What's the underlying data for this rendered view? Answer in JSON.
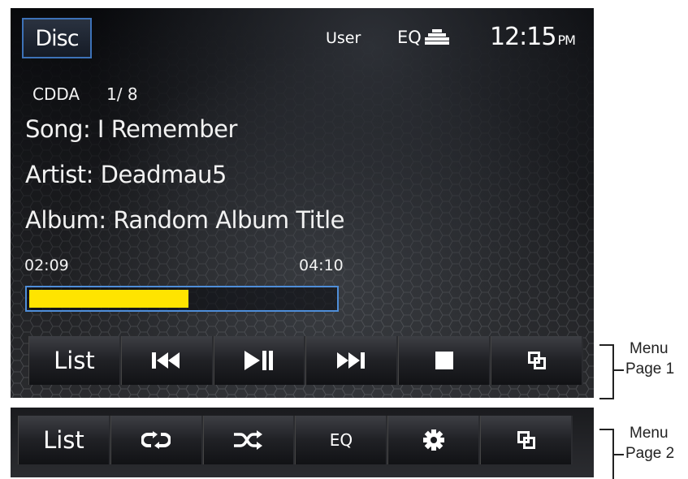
{
  "header": {
    "source_button": "Disc",
    "eq_mode": "User",
    "eq_label": "EQ",
    "clock_time": "12:15",
    "clock_ampm": "PM"
  },
  "track": {
    "format": "CDDA",
    "position": "1/ 8",
    "song": "Song: I Remember",
    "artist": "Artist: Deadmau5",
    "album": "Album: Random Album Title"
  },
  "playback": {
    "elapsed": "02:09",
    "total": "04:10",
    "progress_fraction": 0.52
  },
  "menu_page1": {
    "list_label": "List",
    "icons": [
      "previous-track-icon",
      "play-pause-icon",
      "next-track-icon",
      "stop-icon",
      "page-switch-icon"
    ]
  },
  "menu_page2": {
    "list_label": "List",
    "eq_label": "EQ",
    "icons": [
      "repeat-icon",
      "shuffle-icon",
      "settings-gear-icon",
      "page-switch-icon"
    ]
  },
  "annotations": {
    "menu1_line1": "Menu",
    "menu1_line2": "Page 1",
    "menu2_line1": "Menu",
    "menu2_line2": "Page 2"
  },
  "colors": {
    "progress_fill": "#ffe400",
    "progress_border": "#4f8ed9",
    "disc_border": "#3d72b8"
  }
}
